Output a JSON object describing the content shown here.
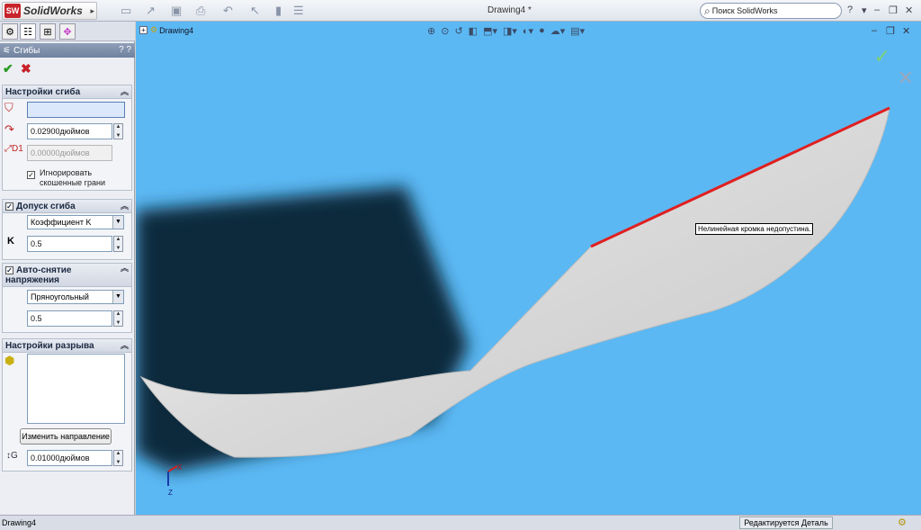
{
  "app": {
    "logo_badge": "SW",
    "logo_name": "SolidWorks",
    "doc_title": "Drawing4 *"
  },
  "search": {
    "placeholder": "Поиск SolidWorks"
  },
  "property_manager": {
    "title": "Сгибы",
    "bend_settings": {
      "header": "Настройки сгиба",
      "radius_value": "0.02900дюймов",
      "offset_value": "0.00000дюймов",
      "ignore_label_line1": "Игнорировать",
      "ignore_label_line2": "скошенные грани"
    },
    "bend_allowance": {
      "header": "Допуск сгиба",
      "type": "Коэффициент K",
      "k_label": "K",
      "k_value": "0.5"
    },
    "auto_relief": {
      "header_line1": "Авто-снятие",
      "header_line2": "напряжения",
      "type": "Пряноугольный",
      "ratio": "0.5"
    },
    "rip_settings": {
      "header": "Настройки разрыва",
      "change_direction": "Изменить направление",
      "gap_value": "0.01000дюймов"
    }
  },
  "viewport": {
    "tree_root": "Drawing4",
    "tooltip": "Нелинейная кромка недопустина.",
    "triad_x": "X",
    "triad_z": "Z",
    "colors": {
      "background": "#5bb8f3",
      "part": "#d8d8d8",
      "edge_highlight": "#e02020"
    }
  },
  "statusbar": {
    "left": "Drawing4",
    "mode": "Редактируется Деталь"
  }
}
